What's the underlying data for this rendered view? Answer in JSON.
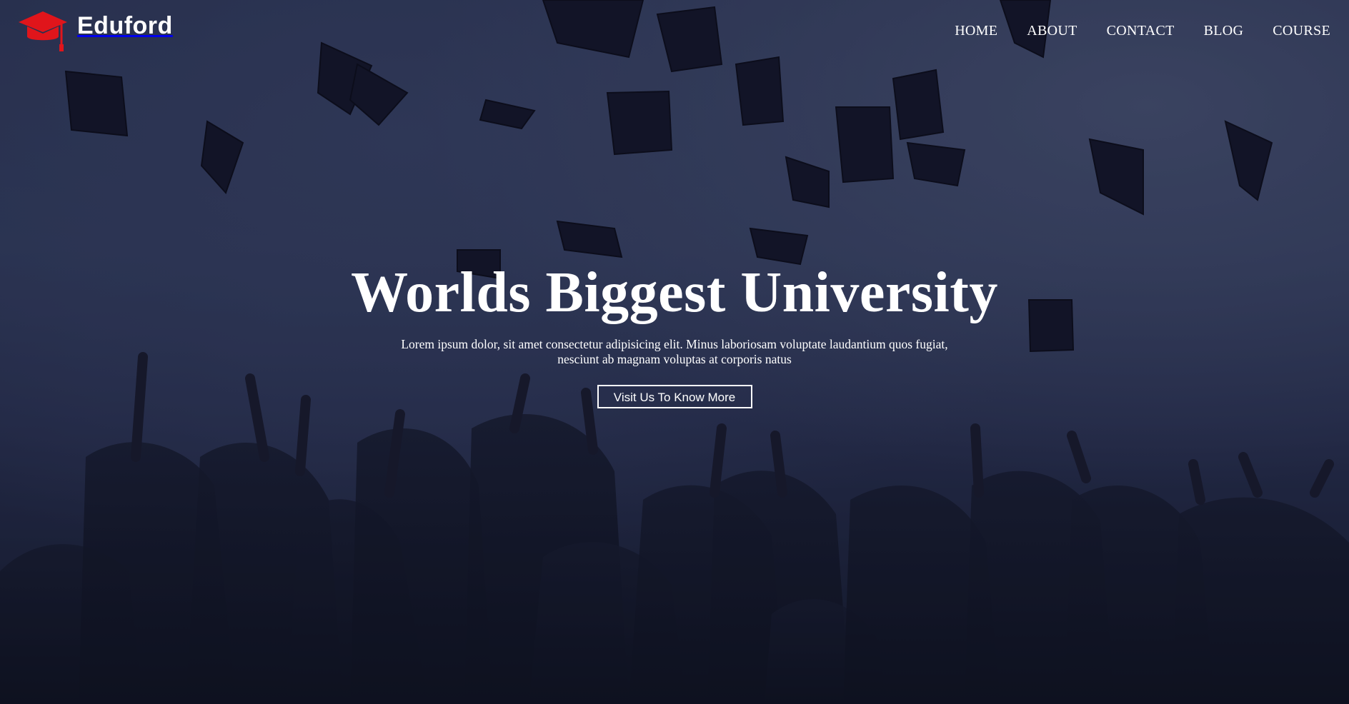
{
  "brand": {
    "name": "Eduford",
    "logo_icon": "graduation-cap-icon",
    "logo_color": "#e0151b"
  },
  "nav": {
    "items": [
      {
        "label": "HOME"
      },
      {
        "label": "ABOUT"
      },
      {
        "label": "CONTACT"
      },
      {
        "label": "BLOG"
      },
      {
        "label": "COURSE"
      }
    ]
  },
  "hero": {
    "title": "Worlds Biggest University",
    "description": "Lorem ipsum dolor, sit amet consectetur adipisicing elit. Minus laboriosam voluptate laudantium quos fugiat, nesciunt ab magnam voluptas at corporis natus",
    "button_label": "Visit Us To Know More",
    "background": "graduates-throwing-caps-photo"
  },
  "colors": {
    "text": "#ffffff",
    "accent": "#e0151b",
    "overlay": "#1e2540"
  }
}
